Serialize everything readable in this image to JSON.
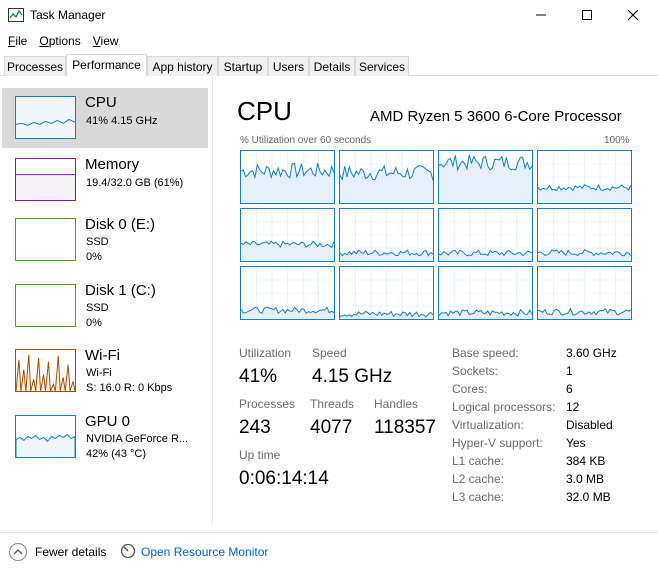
{
  "window": {
    "title": "Task Manager"
  },
  "menu": [
    {
      "label": "File"
    },
    {
      "label": "Options"
    },
    {
      "label": "View"
    }
  ],
  "tabs": [
    {
      "label": "Processes"
    },
    {
      "label": "Performance"
    },
    {
      "label": "App history"
    },
    {
      "label": "Startup"
    },
    {
      "label": "Users"
    },
    {
      "label": "Details"
    },
    {
      "label": "Services"
    }
  ],
  "sidebar": {
    "items": [
      {
        "name": "CPU",
        "line1": "41% 4.15 GHz",
        "line2": "",
        "color": "#1182c2",
        "fill": "#f1f6fa"
      },
      {
        "name": "Memory",
        "line1": "19.4/32.0 GB (61%)",
        "line2": "",
        "color": "#8b12ae",
        "fill": "#f4f2f4"
      },
      {
        "name": "Disk 0 (E:)",
        "line1": "SSD",
        "line2": "0%",
        "color": "#4da60c",
        "fill": "#ffffff"
      },
      {
        "name": "Disk 1 (C:)",
        "line1": "SSD",
        "line2": "0%",
        "color": "#4da60c",
        "fill": "#ffffff"
      },
      {
        "name": "Wi-Fi",
        "line1": "Wi-Fi",
        "line2": "S: 16.0  R: 0 Kbps",
        "color": "#a74f01",
        "fill": "#fcf3eb"
      },
      {
        "name": "GPU 0",
        "line1": "NVIDIA GeForce R...",
        "line2": "42%  (43 °C)",
        "color": "#1182c2",
        "fill": "#f1f6fa"
      }
    ]
  },
  "cpu": {
    "title": "CPU",
    "model": "AMD Ryzen 5 3600 6-Core Processor",
    "graph_caption": "% Utilization over 60 seconds",
    "graph_max": "100%",
    "stats": {
      "utilization_label": "Utilization",
      "utilization": "41%",
      "speed_label": "Speed",
      "speed": "4.15 GHz",
      "processes_label": "Processes",
      "processes": "243",
      "threads_label": "Threads",
      "threads": "4077",
      "handles_label": "Handles",
      "handles": "118357",
      "uptime_label": "Up time",
      "uptime": "0:06:14:14"
    },
    "properties": [
      {
        "label": "Base speed:",
        "value": "3.60 GHz"
      },
      {
        "label": "Sockets:",
        "value": "1"
      },
      {
        "label": "Cores:",
        "value": "6"
      },
      {
        "label": "Logical processors:",
        "value": "12"
      },
      {
        "label": "Virtualization:",
        "value": "Disabled"
      },
      {
        "label": "Hyper-V support:",
        "value": "Yes"
      },
      {
        "label": "L1 cache:",
        "value": "384 KB"
      },
      {
        "label": "L2 cache:",
        "value": "3.0 MB"
      },
      {
        "label": "L3 cache:",
        "value": "32.0 MB"
      }
    ],
    "core_levels": [
      0.62,
      0.58,
      0.78,
      0.3,
      0.32,
      0.16,
      0.15,
      0.16,
      0.17,
      0.1,
      0.12,
      0.14
    ]
  },
  "footer": {
    "fewer_details": "Fewer details",
    "resource_monitor": "Open Resource Monitor"
  },
  "colors": {
    "accent": "#1182c2",
    "link": "#0066cc"
  }
}
